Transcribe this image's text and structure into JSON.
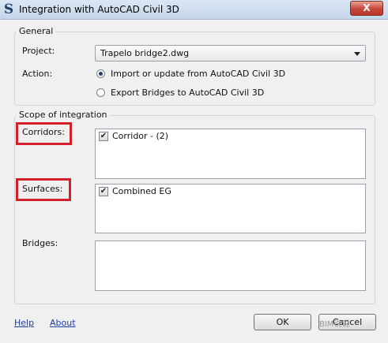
{
  "window": {
    "app_icon": "S",
    "title": "Integration with AutoCAD Civil 3D",
    "close_glyph": "X"
  },
  "general": {
    "legend": "General",
    "project_label": "Project:",
    "project_value": "Trapelo bridge2.dwg",
    "action_label": "Action:",
    "action_options": [
      {
        "label": "Import or update from AutoCAD Civil 3D",
        "checked": true
      },
      {
        "label": "Export Bridges to AutoCAD Civil 3D",
        "checked": false
      }
    ]
  },
  "scope": {
    "legend": "Scope of integration",
    "corridors_label": "Corridors:",
    "corridors_items": [
      {
        "label": "Corridor - (2)",
        "checked": true
      }
    ],
    "surfaces_label": "Surfaces:",
    "surfaces_items": [
      {
        "label": "Combined EG",
        "checked": true
      }
    ],
    "bridges_label": "Bridges:"
  },
  "footer": {
    "help_label": "Help",
    "about_label": "About",
    "ok_label": "OK",
    "cancel_label": "Cancel"
  },
  "watermark": "BIM说说",
  "colors": {
    "highlight": "#d4202a",
    "link": "#1a3ea6"
  },
  "icons": {
    "app": "app-logo-icon",
    "close": "close-icon",
    "dropdown": "chevron-down-icon",
    "check": "checkmark-icon"
  }
}
